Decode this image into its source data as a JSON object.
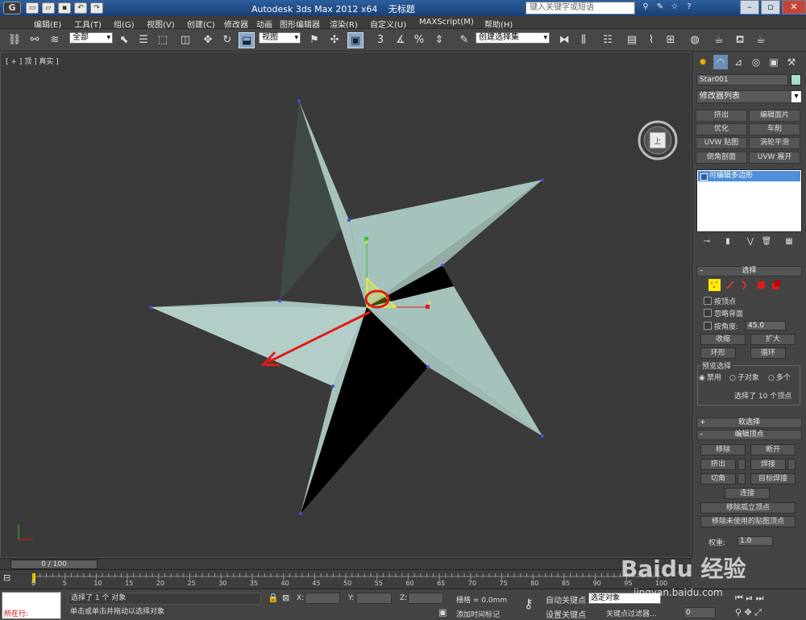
{
  "title": {
    "app": "Autodesk 3ds Max  2012 x64",
    "document": "无标题",
    "search_placeholder": "键入关键字或短语"
  },
  "menu": [
    "编辑(E)",
    "工具(T)",
    "组(G)",
    "视图(V)",
    "创建(C)",
    "修改器",
    "动画",
    "图形编辑器",
    "渲染(R)",
    "自定义(U)",
    "MAXScript(M)",
    "帮助(H)"
  ],
  "toolbar": {
    "selection_filter": "全部",
    "ref_coord": "视图",
    "named_selection": "创建选择集"
  },
  "viewport": {
    "label": "[ + ] 顶 ] 真实 ]"
  },
  "command_panel": {
    "object_name": "Star001",
    "modifier_list": "修改器列表",
    "modifier_buttons": [
      "挤出",
      "编辑面片",
      "优化",
      "车削",
      "UVW 贴图",
      "涡轮平滑",
      "倒角剖面",
      "UVW 展开"
    ],
    "stack_item": "可编辑多边形",
    "selection_rollout": "选择",
    "by_vertex": "按顶点",
    "ignore_backfacing": "忽略背面",
    "by_angle": "按角度:",
    "angle_value": "45.0",
    "shrink": "收缩",
    "grow": "扩大",
    "ring": "环形",
    "loop": "循环",
    "preview_selection": "预览选择",
    "preview_disabled": "禁用",
    "preview_subobject": "子对象",
    "preview_multi": "多个",
    "selection_info": "选择了 10 个顶点",
    "soft_selection": "软选择",
    "edit_vertices": "编辑顶点",
    "remove": "移除",
    "break": "断开",
    "extrude": "挤出",
    "weld": "焊接",
    "chamfer": "切角",
    "target_weld": "目标焊接",
    "connect": "连接",
    "remove_isolated": "移除孤立顶点",
    "remove_unused_map": "移除未使用的贴图顶点",
    "weight_label": "权重:",
    "weight_value": "1.0"
  },
  "timeline": {
    "frame_display": "0 / 100",
    "ticks": [
      "0",
      "5",
      "10",
      "15",
      "20",
      "25",
      "30",
      "35",
      "40",
      "45",
      "50",
      "55",
      "60",
      "65",
      "70",
      "75",
      "80",
      "85",
      "90",
      "95",
      "100"
    ]
  },
  "status": {
    "maxscript_run": "所在行:",
    "line1": "选择了 1 个 对象",
    "line2": "单击或单击并拖动以选择对象",
    "x_label": "X:",
    "y_label": "Y:",
    "z_label": "Z:",
    "grid": "栅格 = 0.0mm",
    "add_time_tag": "添加时间标记",
    "auto_key": "自动关键点",
    "selected_set": "选定对象",
    "set_key": "设置关键点",
    "key_filters": "关键点过滤器...",
    "frame": "0"
  },
  "watermark": {
    "brand": "Baidu 经验",
    "url": "jingyan.baidu.com"
  },
  "colors": {
    "star_face": "#a6c2bc",
    "star_dark": "#3f4a47",
    "gizmo_red": "#e01a1a",
    "selection_blue": "#4f8fd7"
  }
}
